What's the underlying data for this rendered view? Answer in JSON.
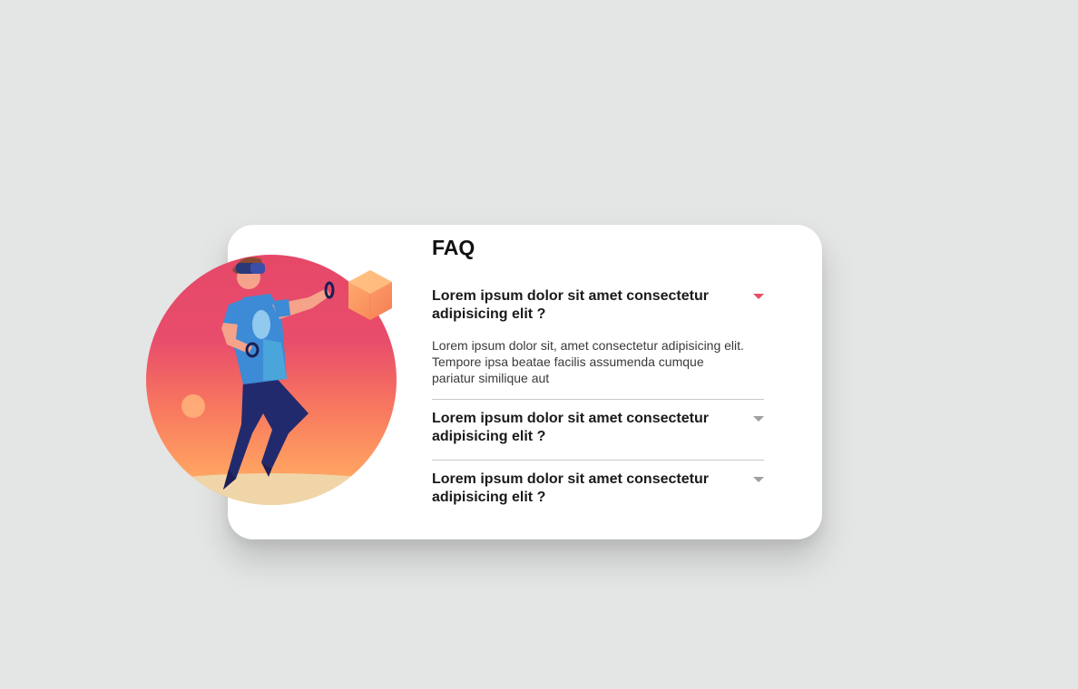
{
  "faq": {
    "title": "FAQ",
    "items": [
      {
        "question": "Lorem ipsum dolor sit amet consectetur adipisicing elit ?",
        "answer": "Lorem ipsum dolor sit, amet consectetur adipisicing elit. Tempore ipsa beatae facilis assumenda cumque pariatur similique aut",
        "expanded": true
      },
      {
        "question": "Lorem ipsum dolor sit amet consectetur adipisicing elit ?",
        "expanded": false
      },
      {
        "question": "Lorem ipsum dolor sit amet consectetur adipisicing elit ?",
        "expanded": false
      }
    ]
  },
  "colors": {
    "background": "#e4e5e5",
    "card": "#ffffff",
    "accent_active_arrow": "#e94e62",
    "inactive_arrow": "#a0a0a0",
    "circle_gradient_top": "#e64a6a",
    "circle_gradient_bottom": "#ffa064"
  },
  "icons": {
    "expanded": "caret-down-icon-active",
    "collapsed": "caret-down-icon"
  }
}
